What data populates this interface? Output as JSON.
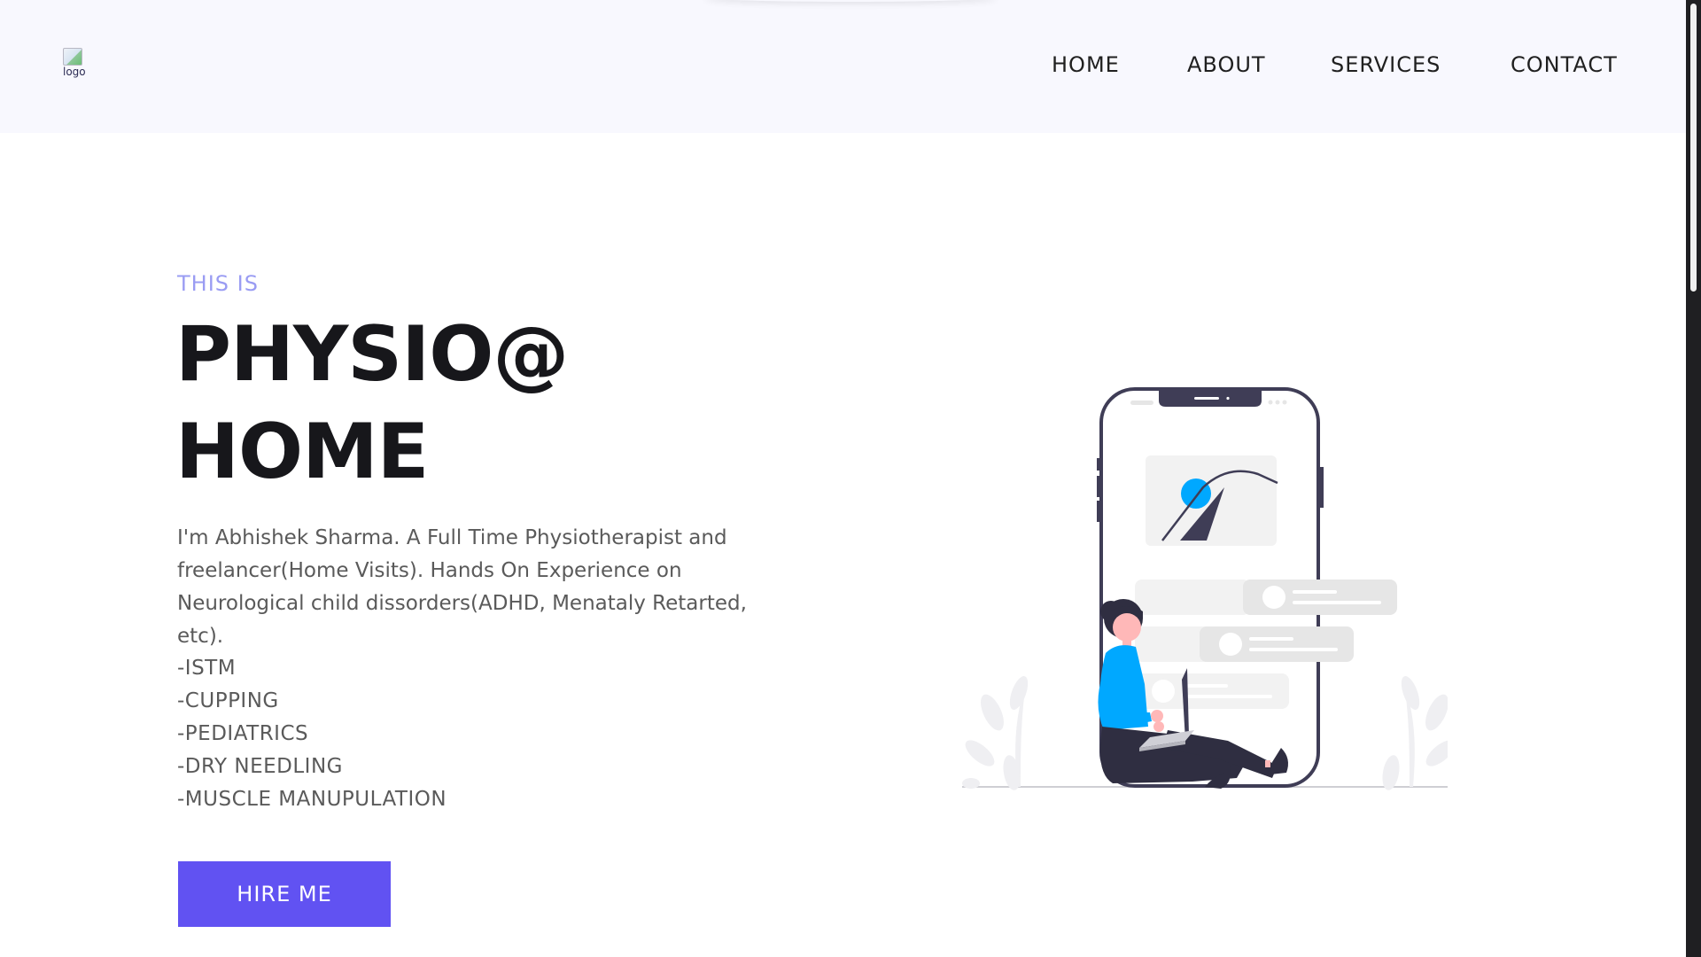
{
  "header": {
    "logo_alt": "logo",
    "nav": [
      {
        "label": "HOME"
      },
      {
        "label": "ABOUT"
      },
      {
        "label": "SERVICES"
      },
      {
        "label": "CONTACT"
      }
    ]
  },
  "hero": {
    "eyebrow": "THIS IS",
    "title_line1": "PHYSIO@",
    "title_line2": "HOME",
    "description": "I'm Abhishek Sharma. A Full Time Physiotherapist and freelancer(Home Visits). Hands On Experience on Neurological child dissorders(ADHD, Menataly Retarted, etc).",
    "skills": [
      "-ISTM",
      "-CUPPING",
      "-PEDIATRICS",
      "-DRY NEEDLING",
      "-MUSCLE MANUPULATION"
    ],
    "cta_label": "HIRE ME"
  },
  "colors": {
    "accent": "#6152f2",
    "eyebrow": "#9a9cf3",
    "header_bg": "#f8f8fe",
    "title": "#17171b",
    "illustration_blue": "#00a8ff"
  },
  "icons": {
    "illustration": "woman-with-laptop-and-phone-illustration"
  }
}
